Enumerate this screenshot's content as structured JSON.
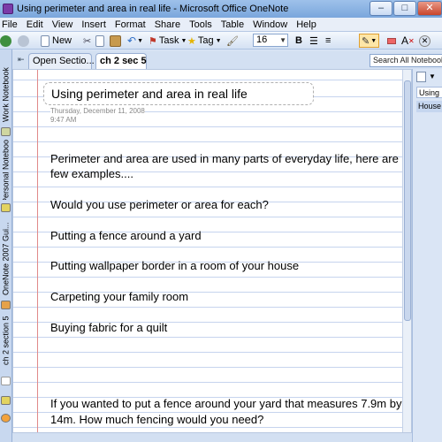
{
  "window": {
    "title": "Using perimeter and area in real life - Microsoft Office OneNote",
    "minimize_glyph": "–",
    "maximize_glyph": "□",
    "close_glyph": "✕"
  },
  "menu": [
    "File",
    "Edit",
    "View",
    "Insert",
    "Format",
    "Share",
    "Tools",
    "Table",
    "Window",
    "Help"
  ],
  "toolbar": {
    "new_label": "New",
    "task_label": "Task",
    "tag_label": "Tag",
    "font_size": "16",
    "bold_label": "B",
    "clear_format_label": "A"
  },
  "notebooks": [
    "Work Notebook",
    "Personal Notebook",
    "OneNote 2007 Gui...",
    "ch 2 section 5"
  ],
  "tabs": {
    "open_sections": "Open Sectio...",
    "active_section": "ch 2 sec 5"
  },
  "search": {
    "placeholder": "Search All Notebooks"
  },
  "page": {
    "title": "Using perimeter and area in real life",
    "date": "Thursday, December 11, 2008",
    "time": "9:47 AM",
    "lines": [
      "Perimeter and area are used in many parts of everyday life, here are a",
      "few examples....",
      "Would you use perimeter or area for each?",
      "Putting a fence around a yard",
      "Putting wallpaper border in a room of your house",
      "Carpeting your family room",
      "Buying fabric for a quilt",
      "If you wanted to put a fence around your yard that measures 7.9m by",
      "14m. How much fencing would you need?"
    ]
  },
  "page_list": [
    "Using",
    "House"
  ],
  "colors": {
    "accent": "#2f6ec7",
    "margin_line": "#e08a8a",
    "rule_line": "#c6d4ee"
  }
}
